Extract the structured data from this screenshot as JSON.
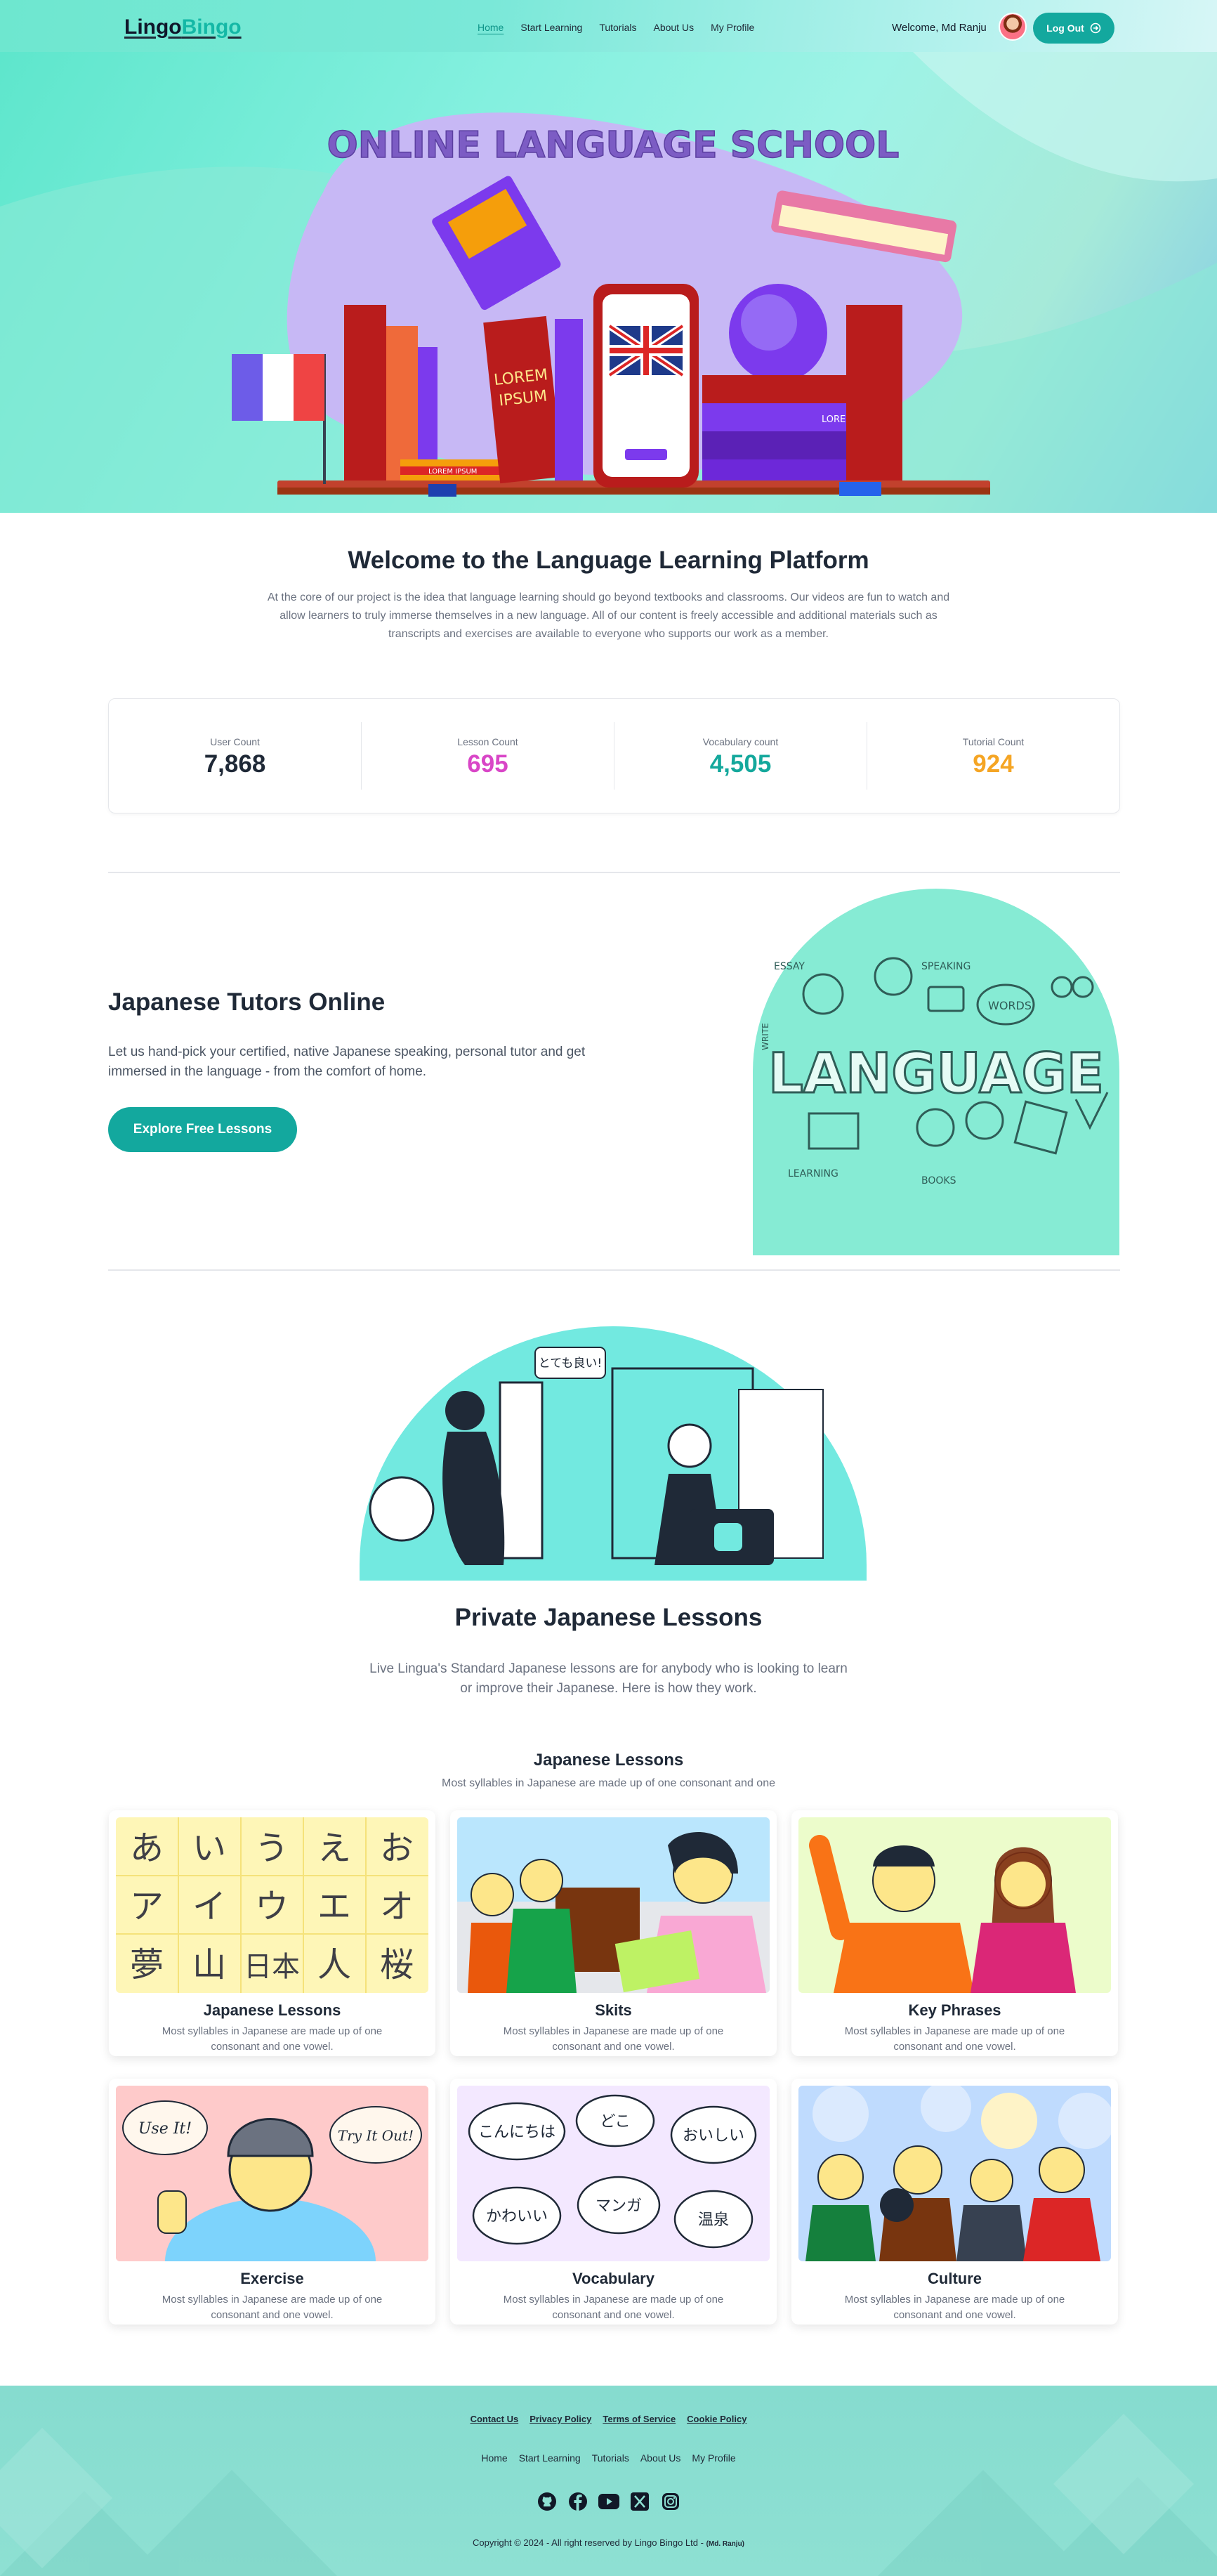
{
  "brand": {
    "part1": "Lingo",
    "part2": "Bingo"
  },
  "nav": {
    "links": [
      "Home",
      "Start Learning",
      "Tutorials",
      "About Us",
      "My Profile"
    ],
    "welcome": "Welcome, Md Ranju",
    "logout": "Log Out"
  },
  "hero": {
    "headline": "ONLINE LANGUAGE SCHOOL",
    "book_text": "LOREM IPSUM"
  },
  "intro": {
    "title": "Welcome to the Language Learning Platform",
    "description": "At the core of our project is the idea that language learning should go beyond textbooks and classrooms. Our videos are fun to watch and allow learners to truly immerse themselves in a new language. All of our content is freely accessible and additional materials such as transcripts and exercises are available to everyone who supports our work as a member."
  },
  "stats": [
    {
      "label": "User Count",
      "value": "7,868",
      "color": "#1f2937"
    },
    {
      "label": "Lesson Count",
      "value": "695",
      "color": "#d946c7"
    },
    {
      "label": "Vocabulary count",
      "value": "4,505",
      "color": "#14a89c"
    },
    {
      "label": "Tutorial Count",
      "value": "924",
      "color": "#f5a524"
    }
  ],
  "tutors": {
    "title": "Japanese Tutors Online",
    "description": "Let us hand-pick your certified, native Japanese speaking, personal tutor and get immersed in the language - from the comfort of home.",
    "button": "Explore Free Lessons",
    "image_word": "LANGUAGE",
    "image_labels": [
      "ESSAY",
      "SPEAKING",
      "WORDS",
      "WRITE",
      "LEARNING",
      "BOOKS"
    ]
  },
  "private": {
    "bubble": "とても良い!",
    "title": "Private Japanese Lessons",
    "description": "Live Lingua's Standard Japanese lessons are for anybody who is looking to learn or improve their Japanese. Here is how they work."
  },
  "lessons": {
    "title": "Japanese Lessons",
    "subtitle": "Most syllables in Japanese are made up of one consonant and one",
    "cards": [
      {
        "title": "Japanese Lessons",
        "desc": "Most syllables in Japanese are made up of one consonant and one vowel."
      },
      {
        "title": "Skits",
        "desc": "Most syllables in Japanese are made up of one consonant and one vowel."
      },
      {
        "title": "Key Phrases",
        "desc": "Most syllables in Japanese are made up of one consonant and one vowel."
      },
      {
        "title": "Exercise",
        "desc": "Most syllables in Japanese are made up of one consonant and one vowel."
      },
      {
        "title": "Vocabulary",
        "desc": "Most syllables in Japanese are made up of one consonant and one vowel."
      },
      {
        "title": "Culture",
        "desc": "Most syllables in Japanese are made up of one consonant and one vowel."
      }
    ],
    "kana": [
      "あ",
      "い",
      "う",
      "え",
      "お",
      "ア",
      "イ",
      "ウ",
      "エ",
      "オ",
      "夢",
      "山",
      "日本",
      "人",
      "桜"
    ],
    "exercise_bubbles": [
      "Use It!",
      "Try It Out!"
    ],
    "vocab_bubbles": [
      "こんにちは",
      "どこ",
      "おいしい",
      "かわいい",
      "マンガ",
      "温泉"
    ]
  },
  "footer": {
    "legal": [
      "Contact Us",
      "Privacy Policy",
      "Terms of Service",
      "Cookie Policy"
    ],
    "links": [
      "Home",
      "Start Learning",
      "Tutorials",
      "About Us",
      "My Profile"
    ],
    "social_icons": [
      "github-icon",
      "facebook-icon",
      "youtube-icon",
      "x-icon",
      "instagram-icon"
    ],
    "copyright": "Copyright © 2024 - All right reserved by Lingo Bingo Ltd -",
    "author": "(Md. Ranju)"
  }
}
